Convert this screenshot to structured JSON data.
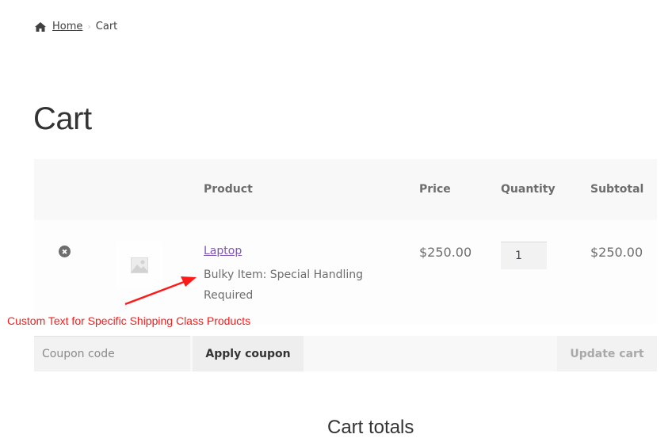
{
  "breadcrumb": {
    "icon": "home-icon",
    "items": [
      "Home",
      "Cart"
    ],
    "separator": "›"
  },
  "page": {
    "title": "Cart"
  },
  "table": {
    "headers": {
      "remove": "",
      "thumbnail": "",
      "product": "Product",
      "price": "Price",
      "quantity": "Quantity",
      "subtotal": "Subtotal"
    },
    "rows": [
      {
        "remove_icon": "close-circle-icon",
        "remove_glyph": "✖",
        "thumbnail_icon": "image-placeholder-icon",
        "product": "Laptop",
        "note": "Bulky Item: Special Handling Required",
        "price": "$250.00",
        "quantity": "1",
        "subtotal": "$250.00"
      }
    ]
  },
  "actions": {
    "coupon_placeholder": "Coupon code",
    "apply_coupon": "Apply coupon",
    "update_cart": "Update cart"
  },
  "annotation": {
    "text": "Custom Text for Specific Shipping Class Products",
    "color": "#ff1a1a"
  },
  "totals": {
    "title": "Cart totals"
  },
  "colors": {
    "link": "#7f54b3",
    "table_header_bg": "#f8f8f8",
    "text": "#6d6d6d"
  }
}
